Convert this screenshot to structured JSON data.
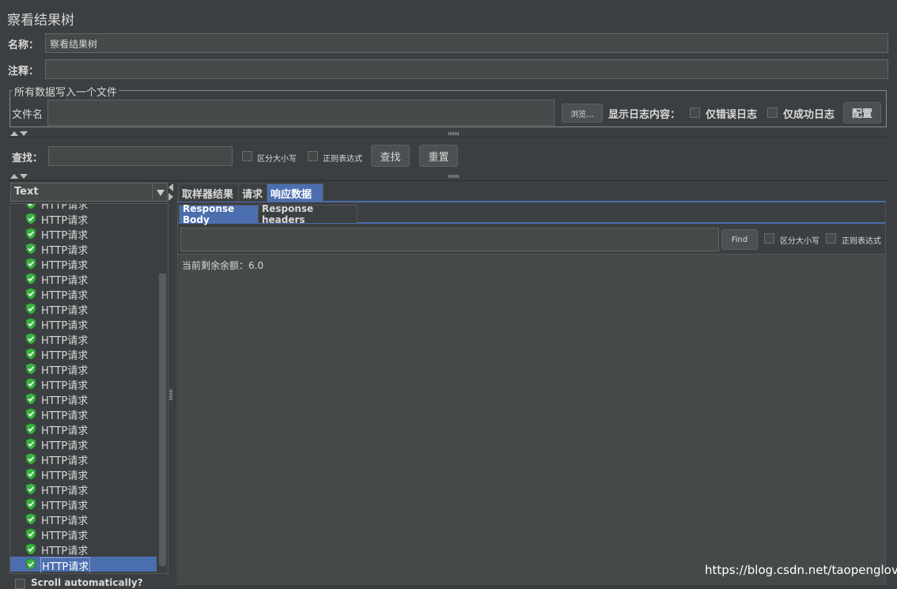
{
  "title": "察看结果树",
  "name_label": "名称：",
  "name_value": "察看结果树",
  "comment_label": "注释：",
  "comment_value": "",
  "file_group": {
    "legend": "所有数据写入一个文件",
    "filename_label": "文件名",
    "filename_value": "",
    "browse_button": "浏览...",
    "log_label": "显示日志内容：",
    "errors_only_label": "仅错误日志",
    "success_only_label": "仅成功日志",
    "config_button": "配置"
  },
  "search": {
    "label": "查找：",
    "value": "",
    "case_label": "区分大小写",
    "regex_label": "正则表达式",
    "find_button": "查找",
    "reset_button": "重置"
  },
  "renderer_select": "Text",
  "tree": {
    "partial_top": "HTTP请求",
    "items": [
      "HTTP请求",
      "HTTP请求",
      "HTTP请求",
      "HTTP请求",
      "HTTP请求",
      "HTTP请求",
      "HTTP请求",
      "HTTP请求",
      "HTTP请求",
      "HTTP请求",
      "HTTP请求",
      "HTTP请求",
      "HTTP请求",
      "HTTP请求",
      "HTTP请求",
      "HTTP请求",
      "HTTP请求",
      "HTTP请求",
      "HTTP请求",
      "HTTP请求",
      "HTTP请求",
      "HTTP请求",
      "HTTP请求",
      "HTTP请求"
    ],
    "selected_label": "HTTP请求",
    "scroll_auto_label": "Scroll automatically?"
  },
  "tabs": {
    "sampler_result": "取样器结果",
    "request": "请求",
    "response_data": "响应数据"
  },
  "subtabs": {
    "response_body": "Response Body",
    "response_headers": "Response headers"
  },
  "response_search": {
    "value": "",
    "find_button": "Find",
    "case_label": "区分大小写",
    "regex_label": "正则表达式"
  },
  "response_body_text": "当前剩余余额：6.0",
  "watermark": "https://blog.csdn.net/taopenglove",
  "colors": {
    "background": "#3c3f41",
    "field": "#45494a",
    "selection": "#4b6eaf",
    "success_icon": "#3cb043"
  }
}
